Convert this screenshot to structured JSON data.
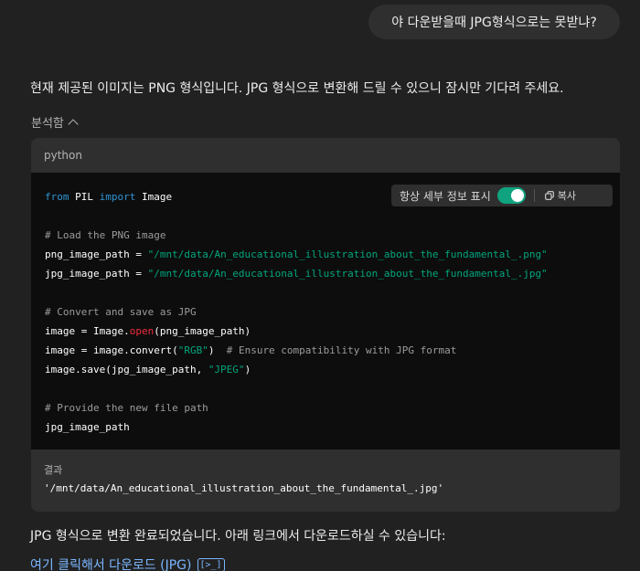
{
  "user_message": "야 다운받을때 JPG형식으로는 못받냐?",
  "assistant": {
    "intro": "현재 제공된 이미지는 PNG 형식입니다. JPG 형식으로 변환해 드릴 수 있으니 잠시만 기다려 주세요.",
    "analysis_label": "분석함",
    "completion": "JPG 형식으로 변환 완료되었습니다. 아래 링크에서 다운로드하실 수 있습니다:",
    "download_link": "여기 클릭해서 다운로드 (JPG)",
    "link_icon": "terminal-icon",
    "link_icon_text": "[>_]"
  },
  "code_block": {
    "language": "python",
    "toolbar": {
      "show_details_label": "항상 세부 정보 표시",
      "toggle_on": true,
      "copy_label": "복사",
      "copy_icon": "copy-icon"
    },
    "lines": {
      "l1_kw1": "from",
      "l1_mod": " PIL ",
      "l1_kw2": "import",
      "l1_name": " Image",
      "l3": "# Load the PNG image",
      "l4_var": "png_image_path = ",
      "l4_str": "\"/mnt/data/An_educational_illustration_about_the_fundamental_.png\"",
      "l5_var": "jpg_image_path = ",
      "l5_str": "\"/mnt/data/An_educational_illustration_about_the_fundamental_.jpg\"",
      "l7": "# Convert and save as JPG",
      "l8_a": "image = Image.",
      "l8_fn": "open",
      "l8_b": "(png_image_path)",
      "l9_a": "image = image.convert(",
      "l9_str": "\"RGB\"",
      "l9_b": ")  ",
      "l9_cm": "# Ensure compatibility with JPG format",
      "l10_a": "image.save(jpg_image_path, ",
      "l10_str": "\"JPEG\"",
      "l10_b": ")",
      "l12": "# Provide the new file path",
      "l13": "jpg_image_path"
    },
    "result_label": "결과",
    "result_value": "'/mnt/data/An_educational_illustration_about_the_fundamental_.jpg'"
  },
  "colors": {
    "background": "#212121",
    "toggle_on": "#10a37f",
    "link": "#7ab7ff",
    "string": "#00a67d",
    "keyword": "#2e95d3",
    "function": "#f22c3d"
  }
}
